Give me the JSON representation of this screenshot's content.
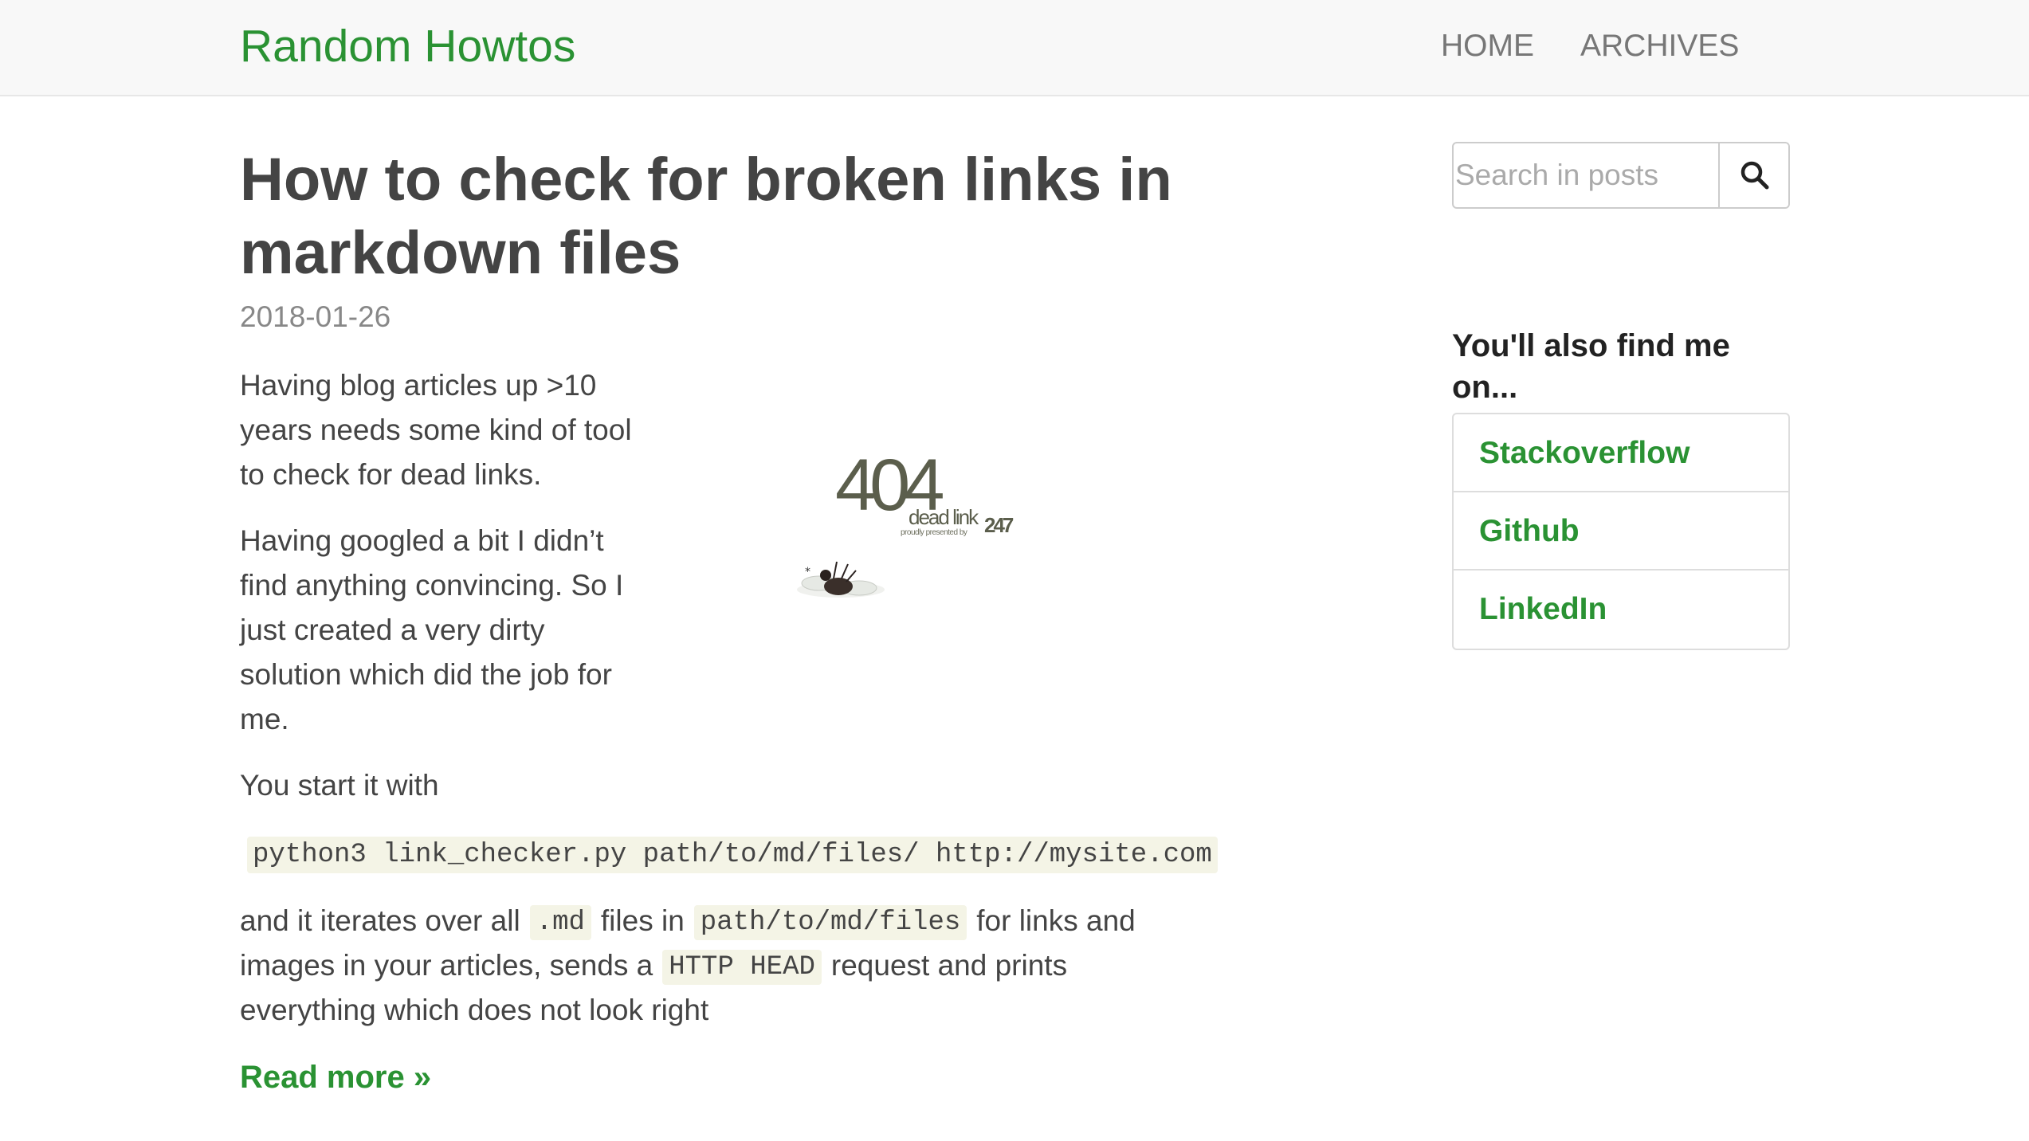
{
  "site": {
    "brand": "Random Howtos",
    "nav": [
      {
        "label": "HOME"
      },
      {
        "label": "ARCHIVES"
      }
    ]
  },
  "post": {
    "title": "How to check for broken links in markdown files",
    "date": "2018-01-26",
    "paragraph1": "Having blog articles up >10 years needs some kind of tool to check for dead links.",
    "paragraph2": "Having googled a bit I didn’t find anything convincing. So I just created a very dirty solution which did the job for me.",
    "paragraph3": "You start it with",
    "command": "python3 link_checker.py path/to/md/files/ http://mysite.com",
    "paragraph4": {
      "t1": "and it iterates over all",
      "code1": ".md",
      "t2": "files in",
      "code2": "path/to/md/files",
      "t3": "for links and",
      "t4": "images in your articles, sends a",
      "code3": "HTTP HEAD",
      "t5": "request and prints",
      "t6": "everything which does not look right"
    },
    "read_more": "Read more »",
    "image": {
      "big_text": "404",
      "sub_text": "dead link",
      "credit_text": "proudly presented by",
      "brand_text": "247",
      "icon": "dead-fly-icon"
    }
  },
  "sidebar": {
    "search_placeholder": "Search in posts",
    "search_icon": "magnifier-icon",
    "find_me_heading": "You'll also find me on...",
    "links": [
      {
        "label": "Stackoverflow"
      },
      {
        "label": "Github"
      },
      {
        "label": "LinkedIn"
      }
    ]
  },
  "colors": {
    "accent": "#2a9233",
    "text": "#444444",
    "muted": "#888888",
    "navbar_bg": "#f8f8f8",
    "code_bg": "#f4f4e6"
  }
}
